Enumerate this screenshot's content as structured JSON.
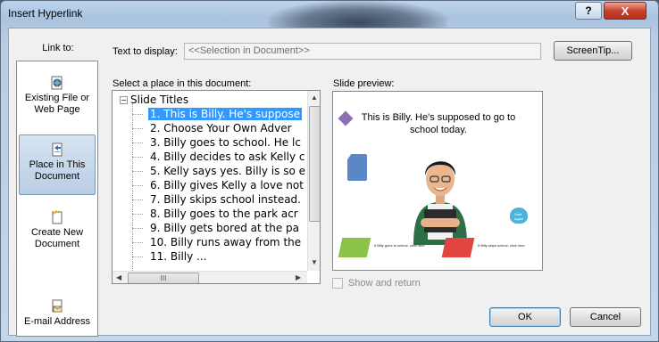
{
  "window": {
    "title": "Insert Hyperlink",
    "help_label": "?",
    "close_label": "X"
  },
  "link_to": {
    "label": "Link to:",
    "items": [
      {
        "label": "Existing File or Web Page",
        "icon": "web-page-icon",
        "selected": false
      },
      {
        "label": "Place in This Document",
        "icon": "document-place-icon",
        "selected": true
      },
      {
        "label": "Create New Document",
        "icon": "new-document-icon",
        "selected": false
      },
      {
        "label": "E-mail Address",
        "icon": "email-icon",
        "selected": false
      }
    ]
  },
  "text_to_display": {
    "label": "Text to display:",
    "value": "<<Selection in Document>>"
  },
  "screentip_label": "ScreenTip...",
  "place_list": {
    "label": "Select a place in this document:",
    "root": "Slide Titles",
    "items": [
      "1. This is Billy. He's suppose",
      "2. Choose Your Own Adver",
      "3. Billy goes to school. He lc",
      "4. Billy decides to ask Kelly c",
      "5. Kelly says yes. Billy is so e",
      "6. Billy gives Kelly a love not",
      "7. Billy skips school instead.",
      "8. Billy goes to the park acr",
      "9. Billy gets bored at the pa",
      "10. Billy runs away from the",
      "11. Billy ..."
    ],
    "selected_index": 0
  },
  "slide_preview": {
    "label": "Slide preview:",
    "slide_text": "This is Billy. He's supposed to go to school today.",
    "green_card_text": "If Billy goes to school, click here",
    "red_card_text": "If Billy skips school, click here",
    "heart_text": "Start Again"
  },
  "show_and_return": {
    "label": "Show and return",
    "checked": false
  },
  "ok_label": "OK",
  "cancel_label": "Cancel"
}
